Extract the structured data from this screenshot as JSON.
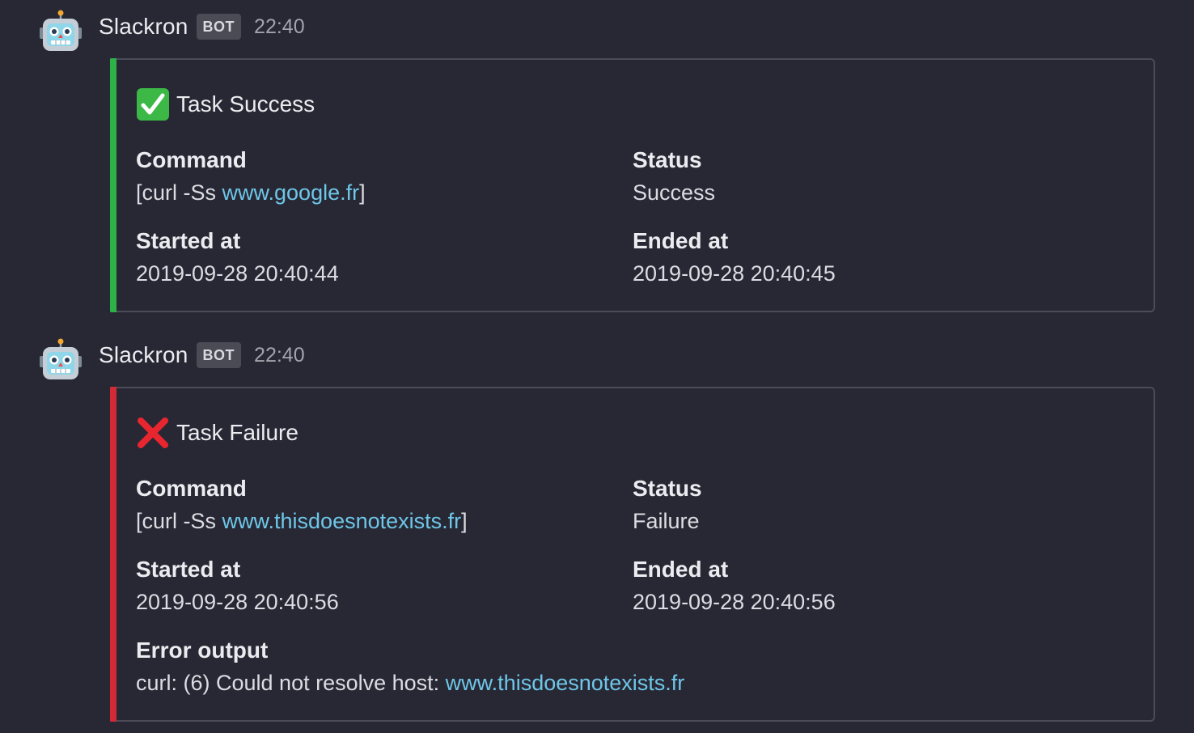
{
  "messages": [
    {
      "username": "Slackron",
      "badge": "BOT",
      "time": "22:40",
      "avatar_icon": "robot-face-icon",
      "attachment": {
        "accent_color": "#2db24a",
        "title_icon": "check-mark-icon",
        "title": "Task Success",
        "fields": {
          "command": {
            "label": "Command",
            "prefix": "[curl -Ss ",
            "link": "www.google.fr",
            "suffix": "]"
          },
          "status": {
            "label": "Status",
            "value": "Success"
          },
          "started": {
            "label": "Started at",
            "value": "2019-09-28 20:40:44"
          },
          "ended": {
            "label": "Ended at",
            "value": "2019-09-28 20:40:45"
          }
        }
      }
    },
    {
      "username": "Slackron",
      "badge": "BOT",
      "time": "22:40",
      "avatar_icon": "robot-face-icon",
      "attachment": {
        "accent_color": "#d42a35",
        "title_icon": "cross-mark-icon",
        "title": "Task Failure",
        "fields": {
          "command": {
            "label": "Command",
            "prefix": "[curl -Ss ",
            "link": "www.thisdoesnotexists.fr",
            "suffix": "]"
          },
          "status": {
            "label": "Status",
            "value": "Failure"
          },
          "started": {
            "label": "Started at",
            "value": "2019-09-28 20:40:56"
          },
          "ended": {
            "label": "Ended at",
            "value": "2019-09-28 20:40:56"
          },
          "error": {
            "label": "Error output",
            "prefix": "curl: (6) Could not resolve host: ",
            "link": "www.thisdoesnotexists.fr"
          }
        }
      }
    }
  ]
}
